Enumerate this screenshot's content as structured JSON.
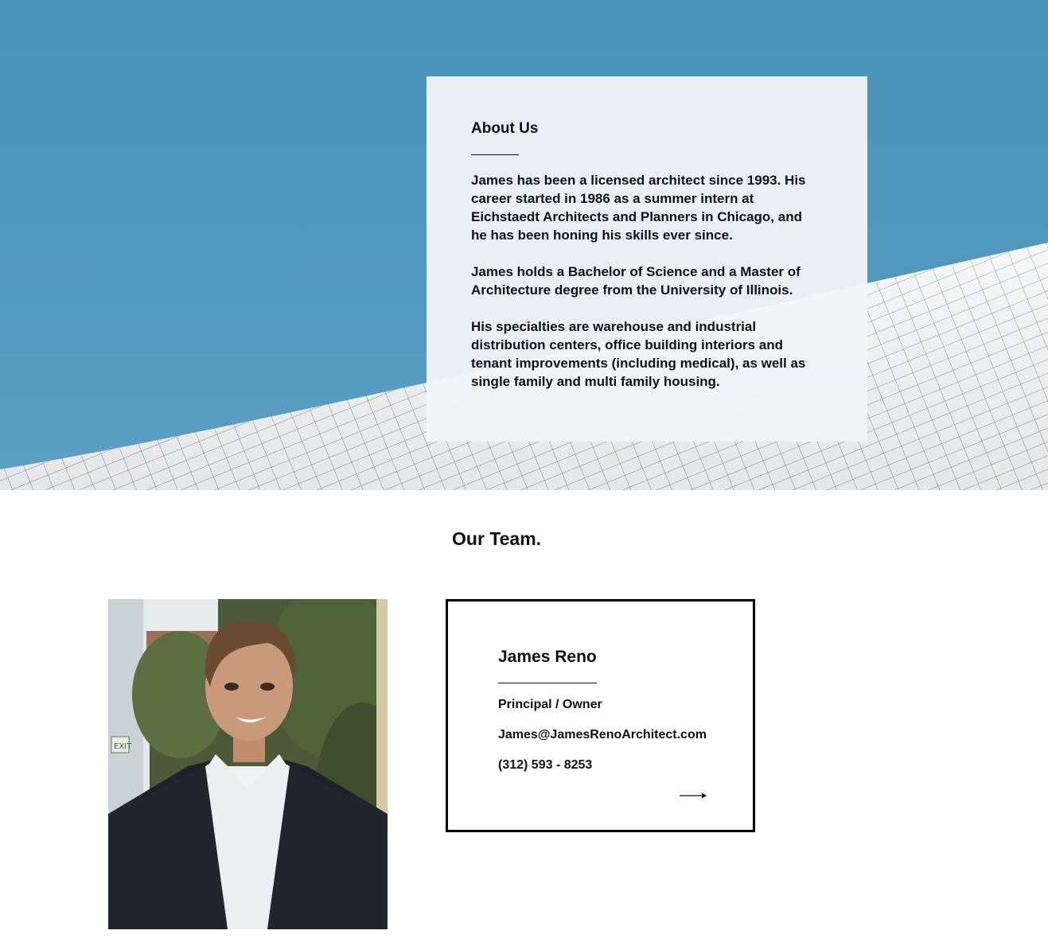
{
  "about": {
    "title": "About Us",
    "paragraphs": [
      "James has been a licensed architect since 1993. His career started in 1986 as a summer intern at Eichstaedt Architects and Planners in Chicago, and he has been honing his skills ever since.",
      "James holds a Bachelor of Science and a Master of Architecture degree from the University of Illinois.",
      "His specialties are warehouse and industrial distribution centers, office building  interiors and tenant improvements (including medical), as well as single family and multi family housing."
    ]
  },
  "team": {
    "title": "Our Team.",
    "member": {
      "name": "James Reno",
      "role": "Principal / Owner",
      "email": "James@JamesRenoArchitect.com",
      "phone": "(312) 593 - 8253"
    }
  },
  "icons": {
    "more": "arrow-right-icon"
  },
  "colors": {
    "sky": "#4a92b8",
    "card": "#f1f6f9",
    "text": "#111111",
    "border": "#000000"
  }
}
